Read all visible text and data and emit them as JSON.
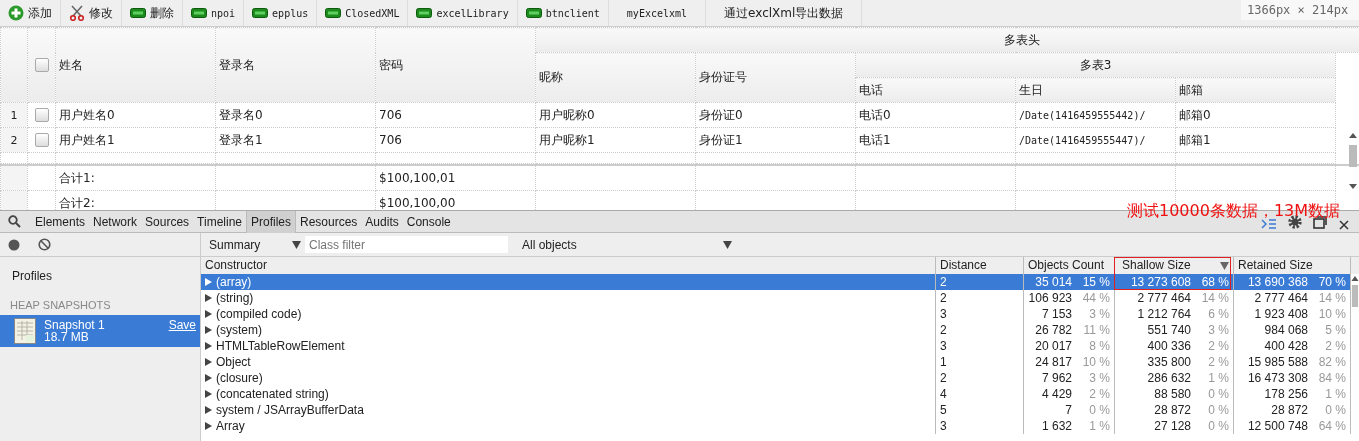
{
  "toolbar": [
    {
      "label": "添加",
      "kind": "add"
    },
    {
      "label": "修改",
      "kind": "edit"
    },
    {
      "label": "删除",
      "kind": "bar"
    },
    {
      "label": "npoi",
      "kind": "bar"
    },
    {
      "label": "epplus",
      "kind": "bar"
    },
    {
      "label": "ClosedXML",
      "kind": "bar"
    },
    {
      "label": "excelLibrary",
      "kind": "bar"
    },
    {
      "label": "btnclient",
      "kind": "bar"
    },
    {
      "label": "myExcelxml",
      "kind": "plain"
    },
    {
      "label": "通过exclXml导出数据",
      "kind": "plain"
    }
  ],
  "size_overlay": "1366px × 214px",
  "grid": {
    "header_all_checked": false,
    "columns": [
      "姓名",
      "登录名",
      "密码"
    ],
    "group": "多表头",
    "group_columns": [
      "昵称",
      "身份证号"
    ],
    "subgroup": "多表3",
    "subgroup_columns": [
      "电话",
      "生日",
      "邮箱"
    ],
    "rows": [
      {
        "num": "1",
        "checked": false,
        "cells": [
          "用户姓名0",
          "登录名0",
          "706",
          "用户昵称0",
          "身份证0",
          "电话0",
          "/Date(1416459555442)/",
          "邮箱0"
        ]
      },
      {
        "num": "2",
        "checked": false,
        "cells": [
          "用户姓名1",
          "登录名1",
          "706",
          "用户昵称1",
          "身份证1",
          "电话1",
          "/Date(1416459555447)/",
          "邮箱1"
        ]
      }
    ],
    "footer": [
      {
        "label": "合计1:",
        "value": "$100,100,01"
      },
      {
        "label": "合计2:",
        "value": "$100,100,00"
      }
    ]
  },
  "annotation": "测试10000条数据，13M数据",
  "devtools": {
    "tabs": [
      {
        "label": "Elements",
        "selected": false
      },
      {
        "label": "Network",
        "selected": false
      },
      {
        "label": "Sources",
        "selected": false
      },
      {
        "label": "Timeline",
        "selected": false
      },
      {
        "label": "Profiles",
        "selected": true
      },
      {
        "label": "Resources",
        "selected": false
      },
      {
        "label": "Audits",
        "selected": false
      },
      {
        "label": "Console",
        "selected": false
      }
    ],
    "view": "Summary",
    "filter_placeholder": "Class filter",
    "objects": "All objects",
    "sidebar": {
      "title": "Profiles",
      "section": "HEAP SNAPSHOTS",
      "snapshots": [
        {
          "name": "Snapshot 1",
          "size": "18.7 MB",
          "action": "Save",
          "selected": true
        }
      ]
    },
    "columns": [
      "Constructor",
      "Distance",
      "Objects Count",
      "Shallow Size",
      "Retained Size"
    ],
    "rows": [
      {
        "name": "(array)",
        "selected": true,
        "distance": "2",
        "count": "35 014",
        "count_pct": "15 %",
        "shallow": "13 273 608",
        "shallow_pct": "68 %",
        "retained": "13 690 368",
        "retained_pct": "70 %"
      },
      {
        "name": "(string)",
        "selected": false,
        "distance": "2",
        "count": "106 923",
        "count_pct": "44 %",
        "shallow": "2 777 464",
        "shallow_pct": "14 %",
        "retained": "2 777 464",
        "retained_pct": "14 %"
      },
      {
        "name": "(compiled code)",
        "selected": false,
        "distance": "3",
        "count": "7 153",
        "count_pct": "3 %",
        "shallow": "1 212 764",
        "shallow_pct": "6 %",
        "retained": "1 923 408",
        "retained_pct": "10 %"
      },
      {
        "name": "(system)",
        "selected": false,
        "distance": "2",
        "count": "26 782",
        "count_pct": "11 %",
        "shallow": "551 740",
        "shallow_pct": "3 %",
        "retained": "984 068",
        "retained_pct": "5 %"
      },
      {
        "name": "HTMLTableRowElement",
        "selected": false,
        "distance": "3",
        "count": "20 017",
        "count_pct": "8 %",
        "shallow": "400 336",
        "shallow_pct": "2 %",
        "retained": "400 428",
        "retained_pct": "2 %"
      },
      {
        "name": "Object",
        "selected": false,
        "distance": "1",
        "count": "24 817",
        "count_pct": "10 %",
        "shallow": "335 800",
        "shallow_pct": "2 %",
        "retained": "15 985 588",
        "retained_pct": "82 %"
      },
      {
        "name": "(closure)",
        "selected": false,
        "distance": "2",
        "count": "7 962",
        "count_pct": "3 %",
        "shallow": "286 632",
        "shallow_pct": "1 %",
        "retained": "16 473 308",
        "retained_pct": "84 %"
      },
      {
        "name": "(concatenated string)",
        "selected": false,
        "distance": "4",
        "count": "4 429",
        "count_pct": "2 %",
        "shallow": "88 580",
        "shallow_pct": "0 %",
        "retained": "178 256",
        "retained_pct": "1 %"
      },
      {
        "name": "system / JSArrayBufferData",
        "selected": false,
        "distance": "5",
        "count": "7",
        "count_pct": "0 %",
        "shallow": "28 872",
        "shallow_pct": "0 %",
        "retained": "28 872",
        "retained_pct": "0 %"
      },
      {
        "name": "Array",
        "selected": false,
        "distance": "3",
        "count": "1 632",
        "count_pct": "1 %",
        "shallow": "27 128",
        "shallow_pct": "0 %",
        "retained": "12 500 748",
        "retained_pct": "64 %"
      }
    ]
  }
}
